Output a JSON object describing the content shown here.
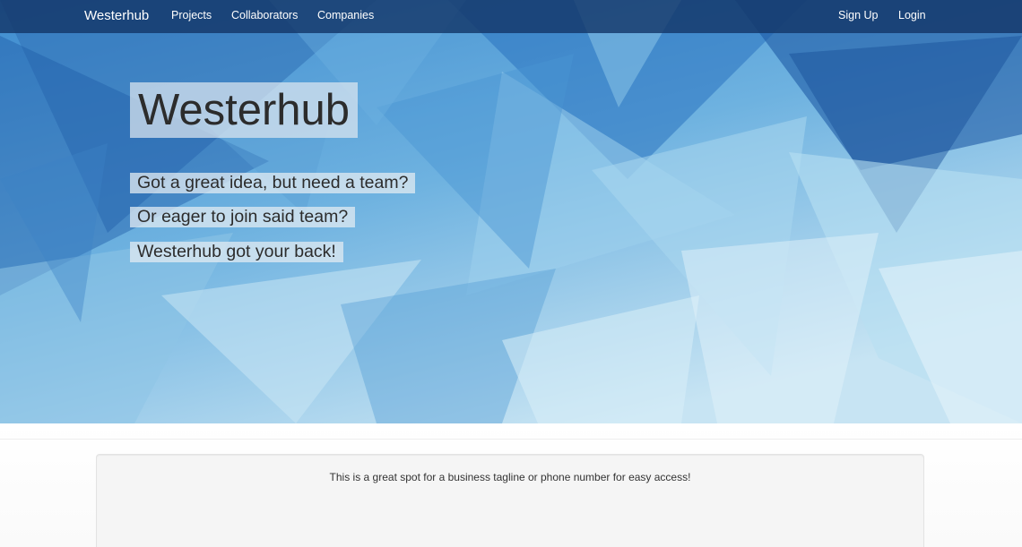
{
  "navbar": {
    "brand": "Westerhub",
    "left_links": [
      "Projects",
      "Collaborators",
      "Companies"
    ],
    "right_links": [
      "Sign Up",
      "Login"
    ]
  },
  "hero": {
    "title": "Westerhub",
    "lines": [
      "Got a great idea, but need a team?",
      "Or eager to join said team?",
      "Westerhub got your back!"
    ]
  },
  "well": {
    "text": "This is a great spot for a business tagline or phone number for easy access!"
  },
  "colors": {
    "navbar": "#143769",
    "hero_base": "#7bbbe0",
    "well_bg": "#f5f5f5"
  }
}
